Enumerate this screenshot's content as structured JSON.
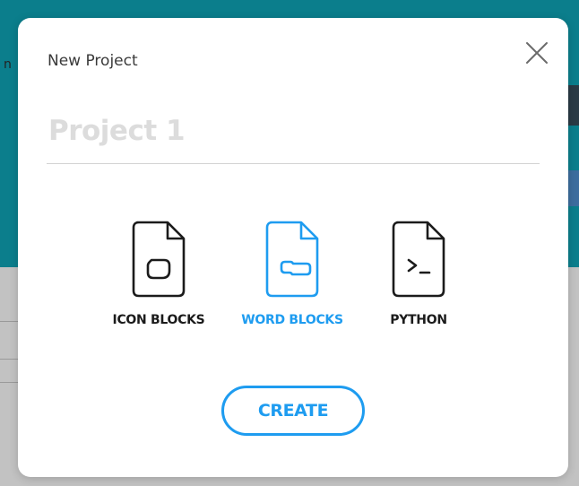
{
  "dialog": {
    "title": "New Project",
    "name_placeholder": "Project 1",
    "name_value": ""
  },
  "project_types": [
    {
      "label": "ICON BLOCKS",
      "icon": "icon-blocks-file-icon",
      "selected": false
    },
    {
      "label": "WORD BLOCKS",
      "icon": "word-blocks-file-icon",
      "selected": true
    },
    {
      "label": "PYTHON",
      "icon": "python-file-icon",
      "selected": false
    }
  ],
  "create_label": "CREATE",
  "close_icon": "close-icon",
  "colors": {
    "accent": "#1e9cf0",
    "text_dark": "#1b1b1b",
    "placeholder": "#dcdcdc",
    "background_teal": "#0b7e8c"
  }
}
